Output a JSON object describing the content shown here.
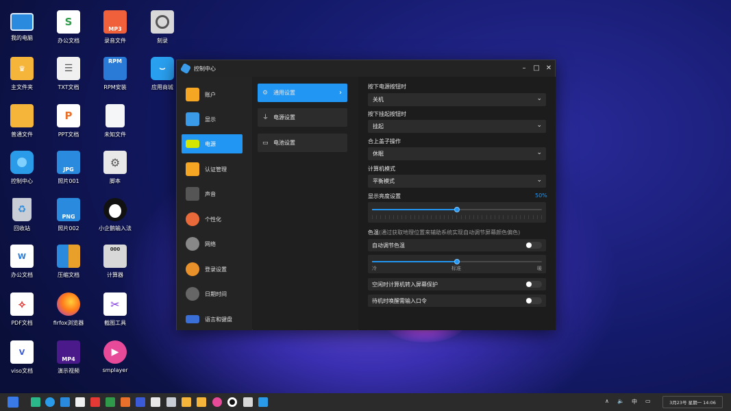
{
  "desktop": {
    "icons": [
      {
        "label": "我的电脑",
        "icon": "computer-icon"
      },
      {
        "label": "办公文档",
        "icon": "spreadsheet-icon"
      },
      {
        "label": "录音文件",
        "icon": "mp3-icon"
      },
      {
        "label": "刻录",
        "icon": "disc-burner-icon"
      },
      {
        "label": "主文件夹",
        "icon": "home-folder-icon"
      },
      {
        "label": "TXT文档",
        "icon": "txt-icon"
      },
      {
        "label": "RPM安装",
        "icon": "rpm-icon"
      },
      {
        "label": "应用商城",
        "icon": "app-store-icon"
      },
      {
        "label": "普通文件",
        "icon": "folder-icon"
      },
      {
        "label": "PPT文档",
        "icon": "ppt-icon"
      },
      {
        "label": "未知文件",
        "icon": "unknown-file-icon"
      },
      {
        "label": "控制中心",
        "icon": "control-center-icon"
      },
      {
        "label": "照片001",
        "icon": "jpg-icon",
        "badge": "JPG"
      },
      {
        "label": "脚本",
        "icon": "script-icon"
      },
      {
        "label": "回收站",
        "icon": "trash-icon"
      },
      {
        "label": "照片002",
        "icon": "png-icon",
        "badge": "PNG"
      },
      {
        "label": "小企鹅输入法",
        "icon": "penguin-icon"
      },
      {
        "label": "办公文档",
        "icon": "word-icon"
      },
      {
        "label": "压缩文档",
        "icon": "archive-icon"
      },
      {
        "label": "计算器",
        "icon": "calculator-icon"
      },
      {
        "label": "PDF文档",
        "icon": "pdf-icon"
      },
      {
        "label": "firfox浏览器",
        "icon": "firefox-icon"
      },
      {
        "label": "截图工具",
        "icon": "screenshot-icon"
      },
      {
        "label": "viso文档",
        "icon": "visio-icon"
      },
      {
        "label": "演示视频",
        "icon": "mp4-icon",
        "badge": "MP4"
      },
      {
        "label": "smplayer",
        "icon": "smplayer-icon"
      }
    ],
    "badges": {
      "mp3": "MP3",
      "rpm": "RPM",
      "s": "S",
      "p": "P",
      "w": "W",
      "v": "V",
      "calc": "000"
    }
  },
  "window": {
    "title": "控制中心",
    "controls": {
      "minimize": "–",
      "maximize": "□",
      "close": "✕"
    },
    "sidebar": [
      {
        "label": "账户",
        "icon": "account-icon",
        "color": "#f5a623"
      },
      {
        "label": "显示",
        "icon": "display-icon",
        "color": "#3a9be8"
      },
      {
        "label": "电源",
        "icon": "battery-icon",
        "color": "#d4e600",
        "active": true
      },
      {
        "label": "认证管理",
        "icon": "auth-icon",
        "color": "#f5a623"
      },
      {
        "label": "声音",
        "icon": "speaker-icon",
        "color": "#555555"
      },
      {
        "label": "个性化",
        "icon": "palette-icon",
        "color": "#e86a3a"
      },
      {
        "label": "网络",
        "icon": "globe-icon",
        "color": "#888888"
      },
      {
        "label": "登录设置",
        "icon": "login-icon",
        "color": "#e8902a"
      },
      {
        "label": "日期时间",
        "icon": "clock-icon",
        "color": "#666666"
      },
      {
        "label": "语言和键盘",
        "icon": "keyboard-icon",
        "color": "#3a6fd8"
      }
    ],
    "subnav": [
      {
        "label": "通用设置",
        "icon": "gear-icon",
        "active": true
      },
      {
        "label": "电源设置",
        "icon": "plug-icon"
      },
      {
        "label": "电池设置",
        "icon": "battery-small-icon"
      }
    ],
    "settings": {
      "power_button_label": "按下电源按钮时",
      "power_button_value": "关机",
      "suspend_button_label": "按下挂起按钮时",
      "suspend_button_value": "挂起",
      "lid_label": "合上盖子操作",
      "lid_value": "休眠",
      "mode_label": "计算机模式",
      "mode_value": "平衡模式",
      "brightness_label": "显示亮度设置",
      "brightness_value": "50%",
      "brightness_fraction": 0.5,
      "color_temp_label": "色温",
      "color_temp_desc": "(通过获取地理位置来辅助系统实现自动调节屏幕颜色偏色)",
      "auto_color_label": "自动调节色温",
      "auto_color_on": false,
      "color_temp_fraction": 0.5,
      "temp_cold": "冷",
      "temp_standard": "标准",
      "temp_warm": "暖",
      "idle_saver_label": "空闲时计算机转入屏幕保护",
      "idle_saver_on": false,
      "wake_password_label": "待机时唤醒需输入口令",
      "wake_password_on": false,
      "chevron": "›",
      "dropdown": "⌄"
    }
  },
  "taskbar": {
    "tray": {
      "up": "∧",
      "volume": "🔈",
      "ime": "中",
      "display": "▭"
    },
    "clock": "3月23号 星期一 14:06"
  }
}
